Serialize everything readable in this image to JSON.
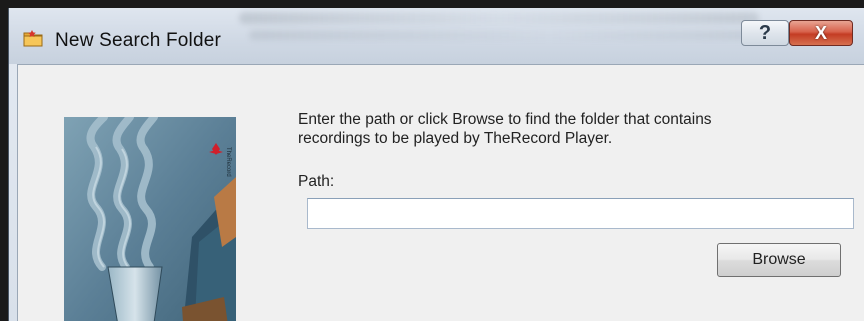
{
  "dialog": {
    "title": "New Search Folder",
    "help_button": "?",
    "close_button": "X"
  },
  "content": {
    "prompt": "Enter the path or click Browse to find the folder that contains\nrecordings to be played by TheRecord Player.",
    "path_label": "Path:",
    "path_value": "",
    "browse_label": "Browse"
  },
  "colors": {
    "close_red": "#c43c24",
    "poster_blue": "#5b7f96",
    "poster_accent": "#d01f2b"
  }
}
